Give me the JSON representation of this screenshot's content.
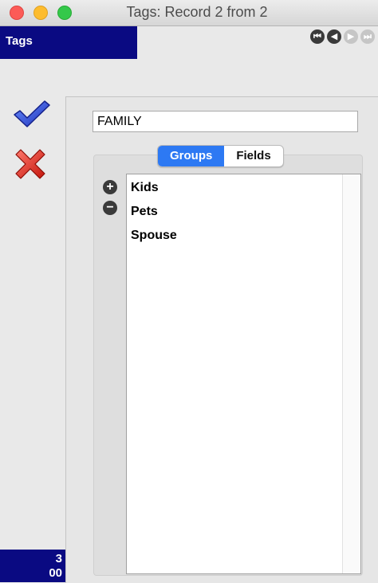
{
  "window": {
    "title": "Tags: Record 2 from 2"
  },
  "header": {
    "module_label": "Tags"
  },
  "nav_buttons": [
    {
      "icon": "first-record-icon",
      "enabled": true
    },
    {
      "icon": "previous-record-icon",
      "enabled": true
    },
    {
      "icon": "next-record-icon",
      "enabled": false
    },
    {
      "icon": "last-record-icon",
      "enabled": false
    }
  ],
  "actions": {
    "accept_icon": "checkmark-icon",
    "cancel_icon": "red-x-icon"
  },
  "counter": {
    "line1": "3",
    "line2": "00"
  },
  "form": {
    "tag_name": "FAMILY"
  },
  "tabs": [
    {
      "label": "Groups",
      "active": true
    },
    {
      "label": "Fields",
      "active": false
    }
  ],
  "groups": {
    "items": [
      "Kids",
      "Pets",
      "Spouse"
    ]
  },
  "colors": {
    "accent_blue": "#2d79f3",
    "header_navy": "#0a0a82"
  }
}
